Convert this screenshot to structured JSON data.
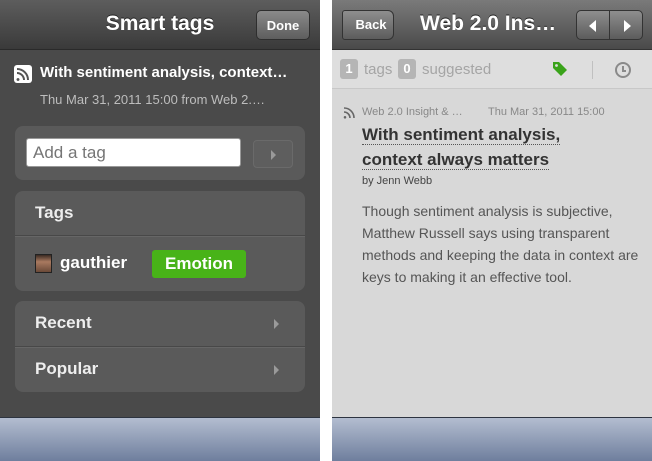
{
  "smart_tags": {
    "nav": {
      "title": "Smart tags",
      "done_label": "Done"
    },
    "article": {
      "title": "With sentiment analysis, context…",
      "meta": "Thu Mar 31, 2011 15:00 from Web 2.…"
    },
    "add_tag": {
      "placeholder": "Add a tag"
    },
    "tags": {
      "header": "Tags",
      "items": [
        {
          "user": "gauthier",
          "tag": "Emotion",
          "tag_color": "#48b318"
        }
      ]
    },
    "navigation": [
      {
        "label": "Recent"
      },
      {
        "label": "Popular"
      }
    ]
  },
  "article_view": {
    "nav": {
      "back_label": "Back",
      "title": "Web 2.0 Ins…"
    },
    "subbar": {
      "tag_count": "1",
      "tags_label": "tags",
      "suggested_count": "0",
      "suggested_label": "suggested",
      "icons": [
        "tag-icon",
        "clock-icon"
      ],
      "tag_icon_color": "#3aa31a"
    },
    "article": {
      "source": "Web 2.0 Insight & …",
      "date": "Thu Mar 31, 2011 15:00",
      "headline_line1": "With sentiment analysis,",
      "headline_line2": "context always matters",
      "byline": "by Jenn Webb",
      "body": "Though sentiment analysis is subjective, Matthew Russell says using transparent methods and keeping the data in context are keys to making it an effective tool."
    }
  },
  "colors": {
    "toolbar": "#8a98b4",
    "left_background": "#4a4a4a",
    "right_background": "#d8d8d8"
  }
}
